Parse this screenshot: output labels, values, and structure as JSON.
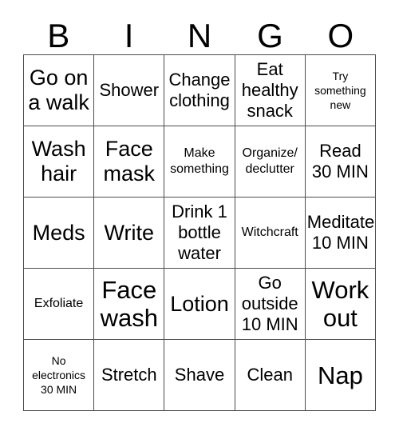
{
  "card": {
    "title": "BINGO",
    "headers": [
      "B",
      "I",
      "N",
      "G",
      "O"
    ],
    "background_color": "#ffffff",
    "border_color": "#4d4d4d",
    "text_color": "#000000",
    "rows": [
      [
        {
          "text": "Go on\na walk",
          "size": "lg"
        },
        {
          "text": "Shower",
          "size": "md"
        },
        {
          "text": "Change\nclothing",
          "size": "md"
        },
        {
          "text": "Eat\nhealthy\nsnack",
          "size": "md"
        },
        {
          "text": "Try\nsomething\nnew",
          "size": "xs"
        }
      ],
      [
        {
          "text": "Wash\nhair",
          "size": "lg"
        },
        {
          "text": "Face\nmask",
          "size": "lg"
        },
        {
          "text": "Make\nsomething",
          "size": "sm"
        },
        {
          "text": "Organize/\ndeclutter",
          "size": "sm"
        },
        {
          "text": "Read\n30 MIN",
          "size": "md"
        }
      ],
      [
        {
          "text": "Meds",
          "size": "lg"
        },
        {
          "text": "Write",
          "size": "lg"
        },
        {
          "text": "Drink 1\nbottle\nwater",
          "size": "md"
        },
        {
          "text": "Witchcraft",
          "size": "sm"
        },
        {
          "text": "Meditate\n10 MIN",
          "size": "md"
        }
      ],
      [
        {
          "text": "Exfoliate",
          "size": "sm"
        },
        {
          "text": "Face\nwash",
          "size": "xl"
        },
        {
          "text": "Lotion",
          "size": "lg"
        },
        {
          "text": "Go\noutside\n10 MIN",
          "size": "md"
        },
        {
          "text": "Work\nout",
          "size": "xl"
        }
      ],
      [
        {
          "text": "No\nelectronics\n30 MIN",
          "size": "xs"
        },
        {
          "text": "Stretch",
          "size": "md"
        },
        {
          "text": "Shave",
          "size": "md"
        },
        {
          "text": "Clean",
          "size": "md"
        },
        {
          "text": "Nap",
          "size": "xl"
        }
      ]
    ]
  }
}
